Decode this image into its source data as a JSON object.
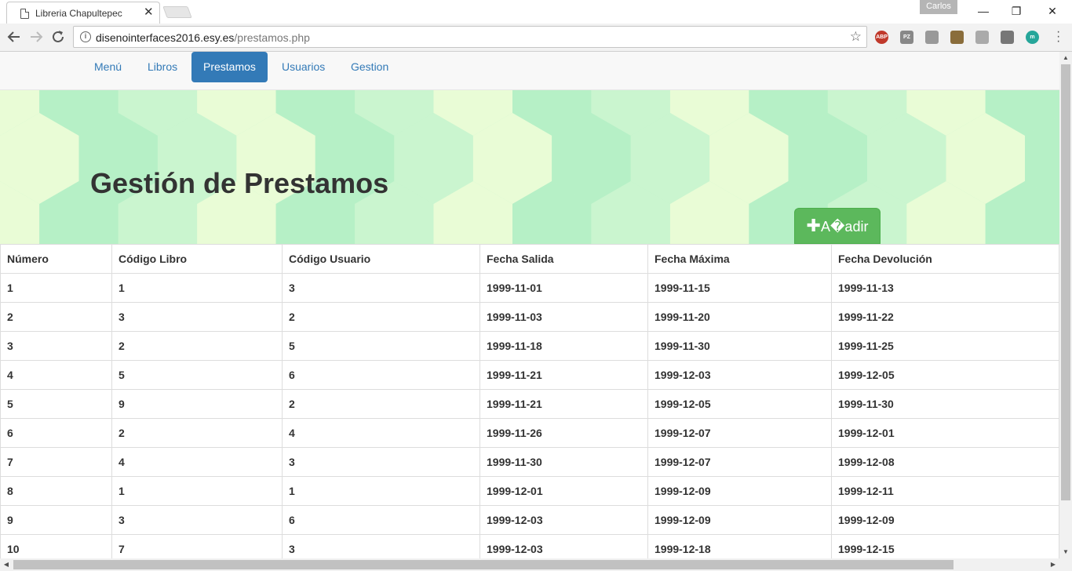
{
  "browser": {
    "tab_title": "Libreria Chapultepec",
    "tab_close": "✕",
    "profile_name": "Carlos",
    "url_host": "disenointerfaces2016.esy.es",
    "url_path": "/prestamos.php",
    "window_controls": {
      "minimize": "—",
      "restore": "❐",
      "close": "✕"
    },
    "extensions": [
      {
        "name": "adblock-plus-icon",
        "label": "ABP",
        "color": "#c0392b"
      },
      {
        "name": "pz-icon",
        "label": "PZ",
        "color": "#888888"
      },
      {
        "name": "camera-icon",
        "label": "",
        "color": "#999999"
      },
      {
        "name": "plant-pot-icon",
        "label": "",
        "color": "#8a6d3b"
      },
      {
        "name": "pencil-icon",
        "label": "",
        "color": "#aaaaaa"
      },
      {
        "name": "evernote-icon",
        "label": "",
        "color": "#777777"
      },
      {
        "name": "m-icon",
        "label": "m",
        "color": "#26a69a"
      }
    ]
  },
  "navbar": {
    "items": [
      {
        "label": "Menú",
        "active": false
      },
      {
        "label": "Libros",
        "active": false
      },
      {
        "label": "Prestamos",
        "active": true
      },
      {
        "label": "Usuarios",
        "active": false
      },
      {
        "label": "Gestion",
        "active": false
      }
    ]
  },
  "jumbotron": {
    "title": "Gestión de Prestamos",
    "add_button_label": "A�adir",
    "add_button_icon": "✚"
  },
  "table": {
    "columns": [
      "Número",
      "Código Libro",
      "Código Usuario",
      "Fecha Salida",
      "Fecha Máxima",
      "Fecha Devolución"
    ],
    "rows": [
      [
        "1",
        "1",
        "3",
        "1999-11-01",
        "1999-11-15",
        "1999-11-13"
      ],
      [
        "2",
        "3",
        "2",
        "1999-11-03",
        "1999-11-20",
        "1999-11-22"
      ],
      [
        "3",
        "2",
        "5",
        "1999-11-18",
        "1999-11-30",
        "1999-11-25"
      ],
      [
        "4",
        "5",
        "6",
        "1999-11-21",
        "1999-12-03",
        "1999-12-05"
      ],
      [
        "5",
        "9",
        "2",
        "1999-11-21",
        "1999-12-05",
        "1999-11-30"
      ],
      [
        "6",
        "2",
        "4",
        "1999-11-26",
        "1999-12-07",
        "1999-12-01"
      ],
      [
        "7",
        "4",
        "3",
        "1999-11-30",
        "1999-12-07",
        "1999-12-08"
      ],
      [
        "8",
        "1",
        "1",
        "1999-12-01",
        "1999-12-09",
        "1999-12-11"
      ],
      [
        "9",
        "3",
        "6",
        "1999-12-03",
        "1999-12-09",
        "1999-12-09"
      ],
      [
        "10",
        "7",
        "3",
        "1999-12-03",
        "1999-12-18",
        "1999-12-15"
      ]
    ]
  },
  "colors": {
    "primary": "#337ab7",
    "success": "#5cb85c",
    "pattern": [
      "#b6f0c6",
      "#a7e8bd",
      "#caf5cf",
      "#dbf8d2",
      "#e9fcd6",
      "#bff2cc"
    ]
  }
}
